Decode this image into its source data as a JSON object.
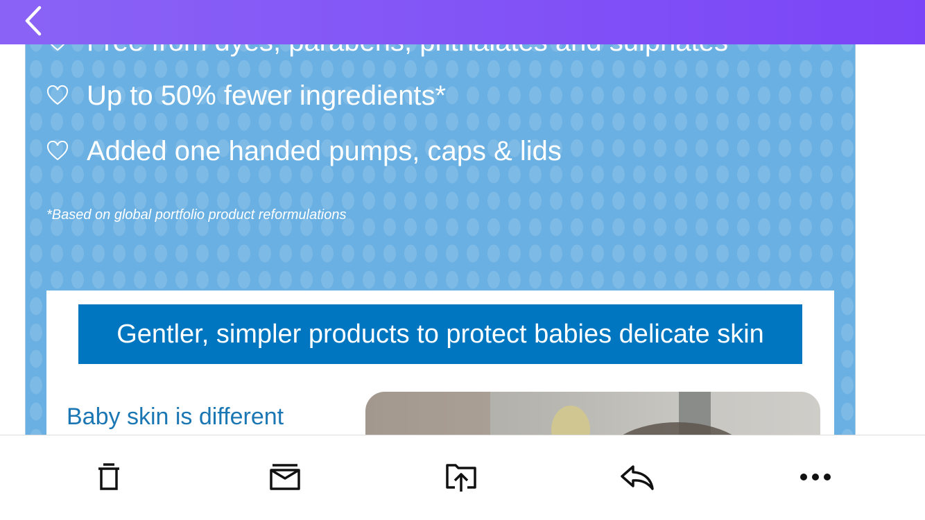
{
  "header": {
    "background_start": "#8a63f6",
    "background_end": "#7b45f7",
    "back_icon": "chevron-left-icon"
  },
  "email": {
    "hero": {
      "background": "#6ab0e2",
      "bullets": [
        {
          "icon": "heart-outline-icon",
          "text": "Free from dyes, parabens, phthalates and sulphates"
        },
        {
          "icon": "heart-outline-icon",
          "text": "Up to 50% fewer ingredients*"
        },
        {
          "icon": "heart-outline-icon",
          "text": "Added one handed pumps, caps & lids"
        }
      ],
      "footnote": "*Based on global portfolio product reformulations"
    },
    "card": {
      "banner_text": "Gentler, simpler products to protect babies delicate skin",
      "banner_color": "#0076c0",
      "subheading": "Baby skin is different",
      "subheading_color": "#1a77b3"
    }
  },
  "toolbar": {
    "items": [
      {
        "icon": "trash-icon"
      },
      {
        "icon": "archive-icon"
      },
      {
        "icon": "move-to-folder-icon"
      },
      {
        "icon": "reply-icon"
      },
      {
        "icon": "more-icon"
      }
    ]
  }
}
